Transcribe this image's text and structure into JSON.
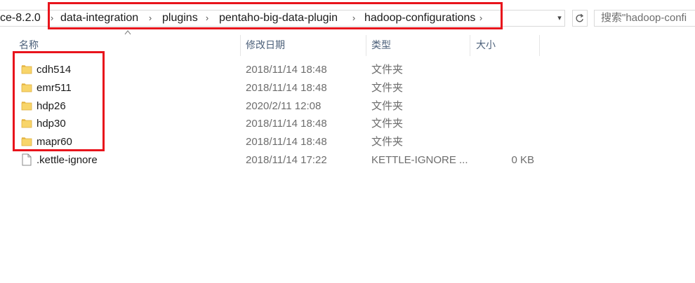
{
  "address_bar": {
    "crumbs": [
      "ce-8.2.0",
      "data-integration",
      "plugins",
      "pentaho-big-data-plugin",
      "hadoop-configurations"
    ],
    "separator": "›",
    "dropdown_glyph": "▾",
    "refresh_icon": "refresh-icon"
  },
  "search": {
    "placeholder": "搜索\"hadoop-confi"
  },
  "columns": {
    "name": "名称",
    "date": "修改日期",
    "type": "类型",
    "size": "大小"
  },
  "files": [
    {
      "name": "cdh514",
      "date": "2018/11/14 18:48",
      "type": "文件夹",
      "size": "",
      "icon": "folder-icon"
    },
    {
      "name": "emr511",
      "date": "2018/11/14 18:48",
      "type": "文件夹",
      "size": "",
      "icon": "folder-icon"
    },
    {
      "name": "hdp26",
      "date": "2020/2/11 12:08",
      "type": "文件夹",
      "size": "",
      "icon": "folder-icon"
    },
    {
      "name": "hdp30",
      "date": "2018/11/14 18:48",
      "type": "文件夹",
      "size": "",
      "icon": "folder-icon"
    },
    {
      "name": "mapr60",
      "date": "2018/11/14 18:48",
      "type": "文件夹",
      "size": "",
      "icon": "folder-icon"
    },
    {
      "name": ".kettle-ignore",
      "date": "2018/11/14 17:22",
      "type": "KETTLE-IGNORE ...",
      "size": "0 KB",
      "icon": "file-icon"
    }
  ],
  "colors": {
    "highlight_box": "#e8141c",
    "folder": "#f8d56a",
    "column_header_text": "#4c607a",
    "secondary_text": "#6d6d6d"
  }
}
